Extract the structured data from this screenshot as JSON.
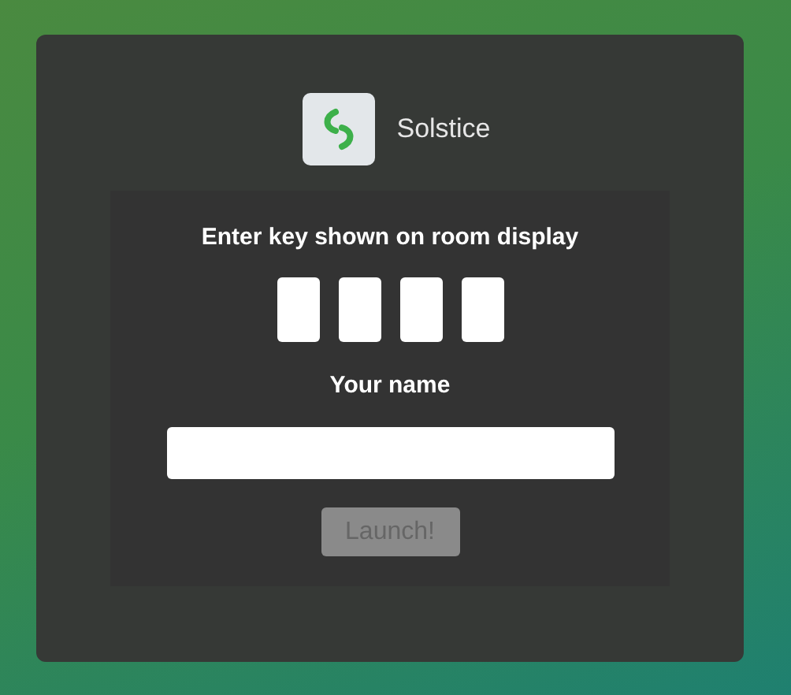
{
  "app": {
    "title": "Solstice"
  },
  "key_prompt": "Enter key shown on room display",
  "key_fields": [
    {
      "kind": "digit"
    },
    {
      "kind": "digit"
    },
    {
      "kind": "digit"
    },
    {
      "kind": "digit"
    }
  ],
  "name_label": "Your name",
  "name_field": {
    "kind": "text"
  },
  "launch_button": {
    "label": "Launch!",
    "disabled": true
  }
}
